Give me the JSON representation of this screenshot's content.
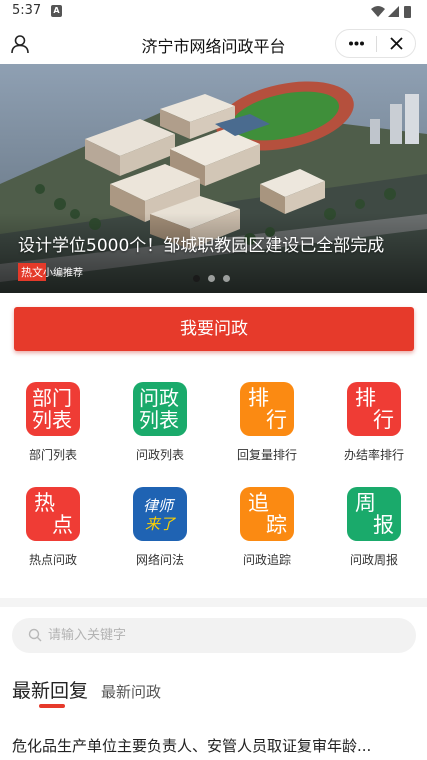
{
  "status_bar": {
    "time": "5:37",
    "notif_badge": "A"
  },
  "title_bar": {
    "title": "济宁市网络问政平台"
  },
  "banner": {
    "headline": "设计学位5000个！邹城职教园区建设已全部完成",
    "tag": "热文",
    "tag_sub": "小编推荐",
    "slide_count": 3,
    "active_slide": 1
  },
  "ask_button": {
    "label": "我要问政"
  },
  "menu": [
    {
      "icon_line1": "部门",
      "icon_line2": "列表",
      "label": "部门列表",
      "color": "#ef3c35"
    },
    {
      "icon_line1": "问政",
      "icon_line2": "列表",
      "label": "问政列表",
      "color": "#1aaa6b"
    },
    {
      "icon_line1": "排",
      "icon_line2": "行",
      "label": "回复量排行",
      "color": "#fb8a12"
    },
    {
      "icon_line1": "排",
      "icon_line2": "行",
      "label": "办结率排行",
      "color": "#ef3c35"
    },
    {
      "icon_line1": "热",
      "icon_line2": "点",
      "label": "热点问政",
      "color": "#ef3c35"
    },
    {
      "icon_line1": "律师",
      "icon_line2": "来了",
      "label": "网络问法",
      "color": "#1f63b3"
    },
    {
      "icon_line1": "追",
      "icon_line2": "踪",
      "label": "问政追踪",
      "color": "#fb8a12"
    },
    {
      "icon_line1": "周",
      "icon_line2": "报",
      "label": "问政周报",
      "color": "#1aaa6b"
    }
  ],
  "search": {
    "placeholder": "请输入关键字",
    "value": ""
  },
  "tabs": [
    {
      "label": "最新回复",
      "active": true
    },
    {
      "label": "最新问政",
      "active": false
    }
  ],
  "news": [
    {
      "title": "危化品生产单位主要负责人、安管人员取证复审年龄..."
    }
  ]
}
